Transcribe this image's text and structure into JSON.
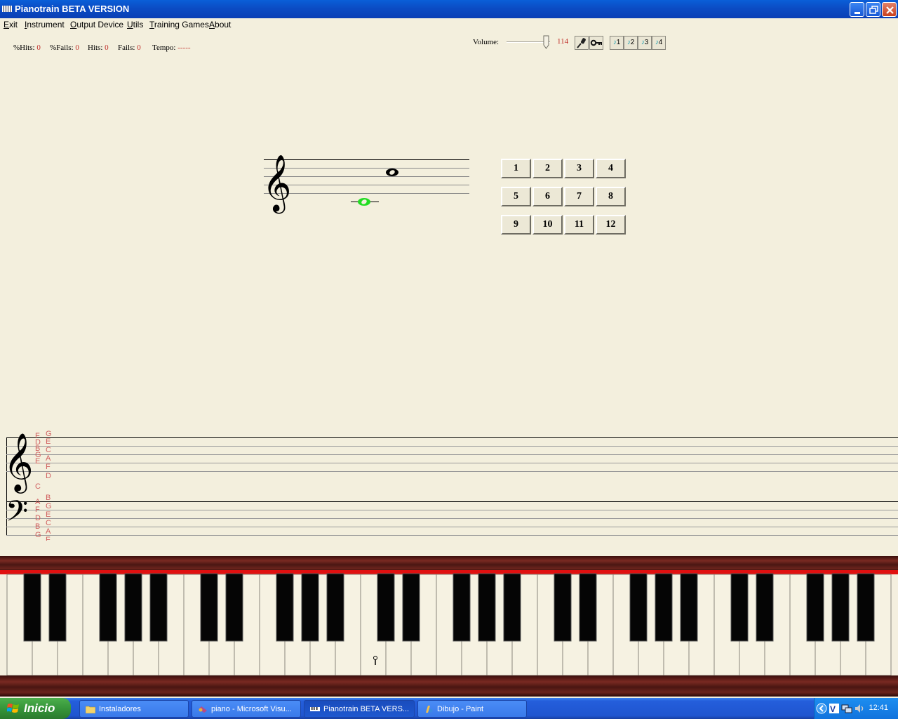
{
  "window": {
    "title": "Pianotrain BETA VERSION"
  },
  "menu": [
    {
      "label_u": "E",
      "label_rest": "xit"
    },
    {
      "label_u": "I",
      "label_rest": "nstrument"
    },
    {
      "label_u": "O",
      "label_rest": "utput Device"
    },
    {
      "label_u": "U",
      "label_rest": "tils"
    },
    {
      "label_u": "T",
      "label_rest": "raining Games"
    },
    {
      "label_u": "A",
      "label_rest": "bout"
    }
  ],
  "stats": {
    "pct_hits_label": "%Hits:",
    "pct_hits": "0",
    "pct_fails_label": "%Fails:",
    "pct_fails": "0",
    "hits_label": "Hits:",
    "hits": "0",
    "fails_label": "Fails:",
    "fails": "0",
    "tempo_label": "Tempo:",
    "tempo": "-----"
  },
  "volume": {
    "label": "Volume:",
    "value": "114",
    "level": 0.85
  },
  "tools": {
    "mic_icon": "microphone-icon",
    "key_icon": "key-icon",
    "presets": [
      "1",
      "2",
      "3",
      "4"
    ]
  },
  "number_buttons": [
    "1",
    "2",
    "3",
    "4",
    "5",
    "6",
    "7",
    "8",
    "9",
    "10",
    "11",
    "12"
  ],
  "grand_staff": {
    "treble_col1": [
      "F",
      "D",
      "B",
      "G",
      "E",
      "",
      "C"
    ],
    "treble_col2": [
      "G",
      "E",
      "C",
      "A",
      "F",
      "D"
    ],
    "bass_col1": [
      "A",
      "F",
      "D",
      "B",
      "G"
    ],
    "bass_col2": [
      "B",
      "G",
      "E",
      "C",
      "A",
      "F"
    ]
  },
  "taskbar": {
    "start_label": "Inicio",
    "tasks": [
      {
        "label": "Instaladores",
        "icon": "folder-icon"
      },
      {
        "label": "piano - Microsoft Visu...",
        "icon": "visual-studio-icon"
      },
      {
        "label": "Pianotrain BETA VERS...",
        "icon": "pianotrain-icon"
      },
      {
        "label": "Dibujo - Paint",
        "icon": "paint-icon"
      }
    ],
    "clock": "12:41"
  },
  "colors": {
    "accent_red": "#c0302a",
    "note_green": "#22dd22",
    "piano_wood": "#5a1c16"
  }
}
